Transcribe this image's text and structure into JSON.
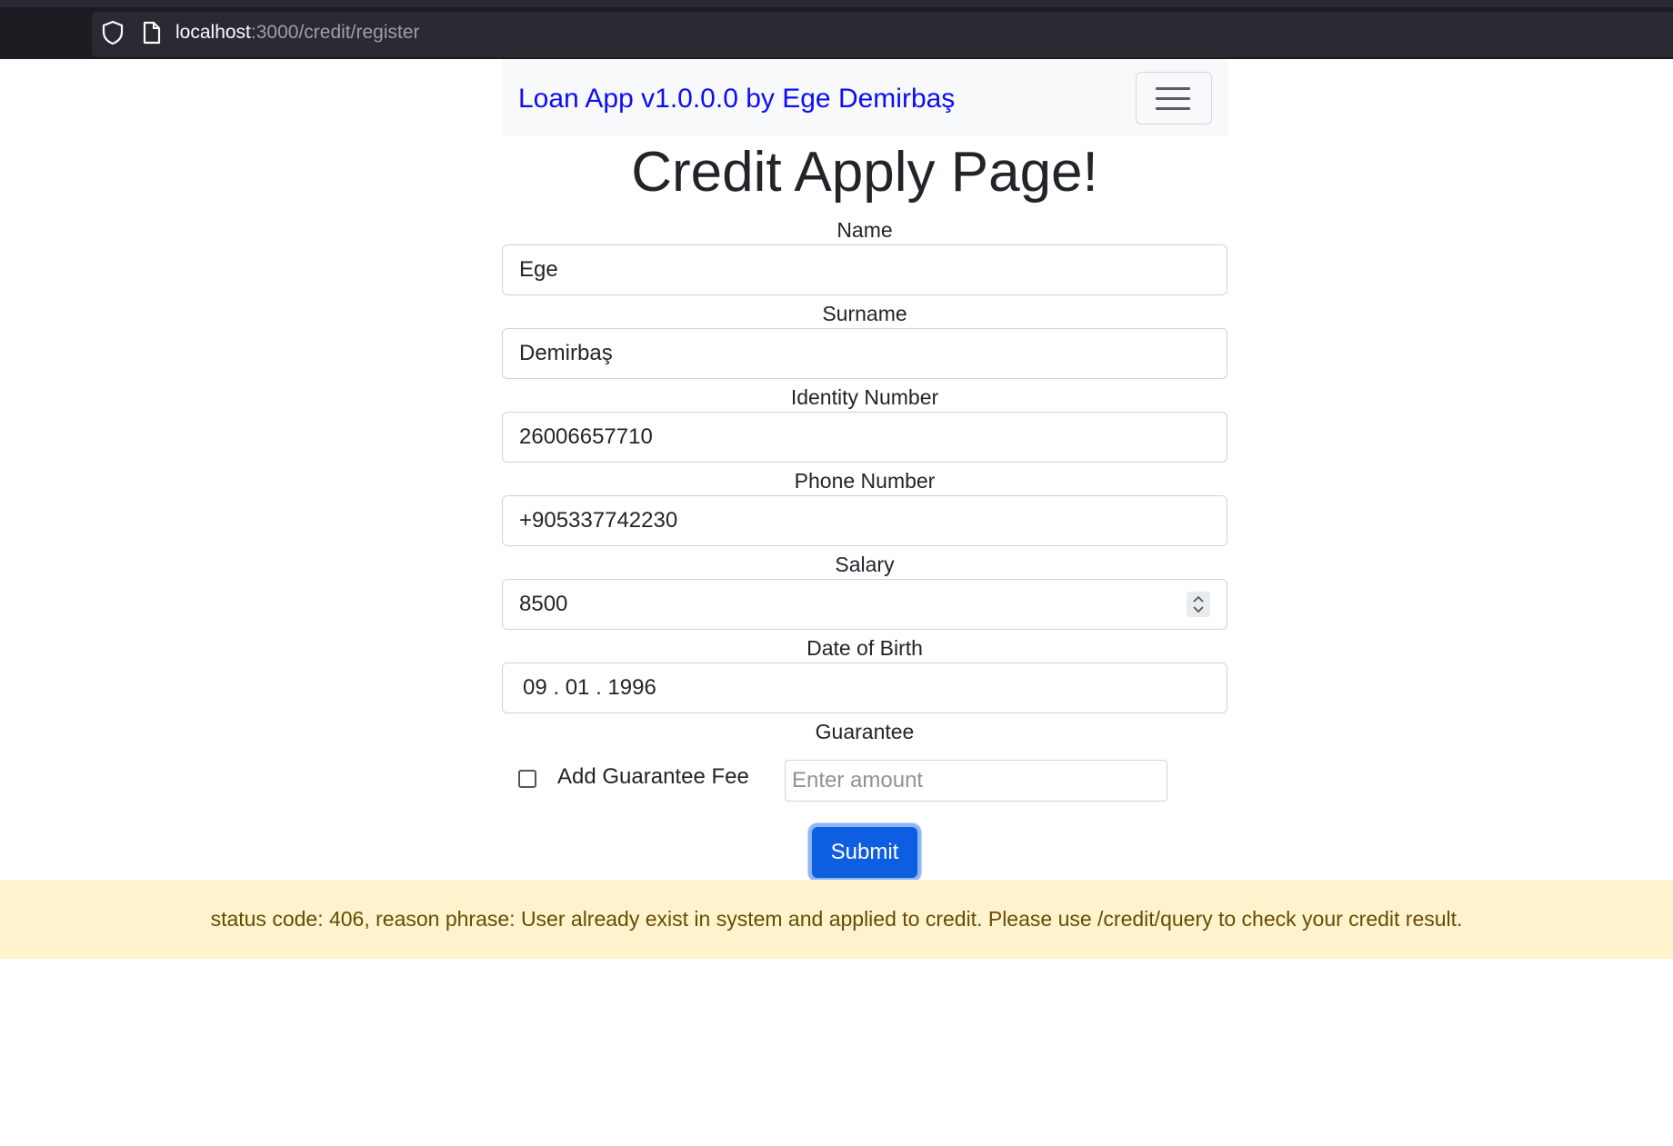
{
  "browser": {
    "url_host": "localhost",
    "url_path": ":3000/credit/register"
  },
  "navbar": {
    "brand": "Loan App v1.0.0.0 by Ege Demirbaş"
  },
  "page": {
    "title": "Credit Apply Page!"
  },
  "form": {
    "name_label": "Name",
    "name_value": "Ege",
    "surname_label": "Surname",
    "surname_value": "Demirbaş",
    "identity_label": "Identity Number",
    "identity_value": "26006657710",
    "phone_label": "Phone Number",
    "phone_value": "+905337742230",
    "salary_label": "Salary",
    "salary_value": "8500",
    "dob_label": "Date of Birth",
    "dob_value": "09 . 01 . 1996",
    "guarantee_label": "Guarantee",
    "guarantee_checkbox_label": "Add Guarantee Fee",
    "guarantee_checked": false,
    "guarantee_amount_placeholder": "Enter amount",
    "submit_label": "Submit"
  },
  "alert": {
    "message": "status code: 406, reason phrase: User already exist in system and applied to credit. Please use /credit/query to check your credit result.",
    "color": "#fff3cd"
  },
  "colors": {
    "brand": "#0d0df5",
    "primary_button": "#0d5ee0"
  }
}
